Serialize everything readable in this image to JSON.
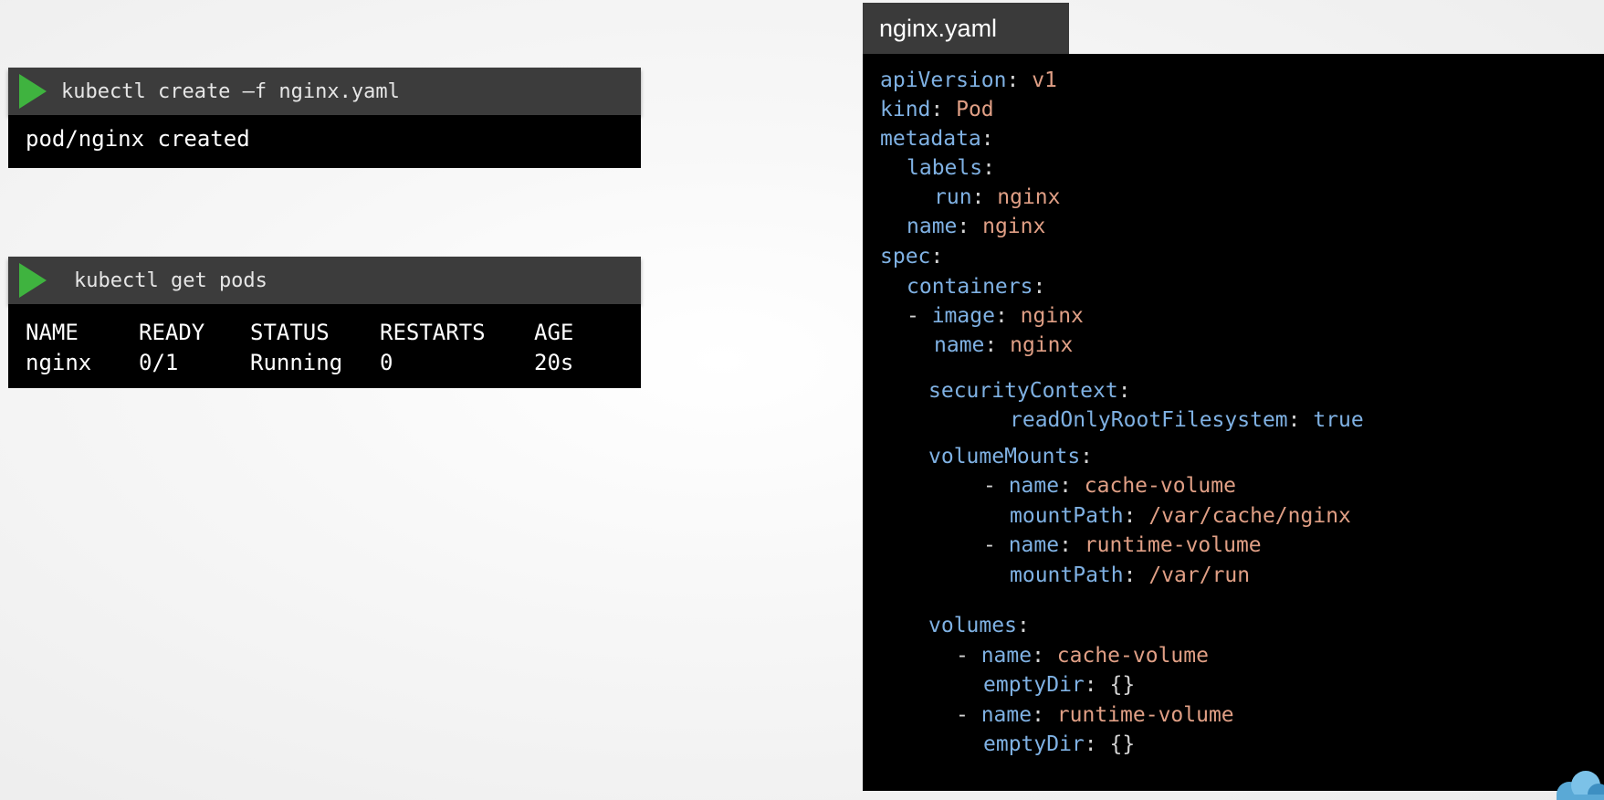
{
  "terminal1": {
    "command": "kubectl create –f nginx.yaml",
    "output": "pod/nginx created"
  },
  "terminal2": {
    "command": "kubectl get pods",
    "headers": [
      "NAME",
      "READY",
      "STATUS",
      "RESTARTS",
      "AGE"
    ],
    "rows": [
      [
        "nginx",
        "0/1",
        "Running",
        "0",
        "20s"
      ]
    ]
  },
  "file": {
    "tab_label": "nginx.yaml",
    "tokens": {
      "apiVersion_key": "apiVersion",
      "apiVersion_val": "v1",
      "kind_key": "kind",
      "kind_val": "Pod",
      "metadata_key": "metadata",
      "labels_key": "labels",
      "run_key": "run",
      "run_val": "nginx",
      "name_key": "name",
      "name_val": "nginx",
      "spec_key": "spec",
      "containers_key": "containers",
      "image_key": "image",
      "image_val": "nginx",
      "cname_key": "name",
      "cname_val": "nginx",
      "securityContext_key": "securityContext",
      "readOnly_key": "readOnlyRootFilesystem",
      "readOnly_val": "true",
      "volumeMounts_key": "volumeMounts",
      "vm1_name_key": "name",
      "vm1_name_val": "cache-volume",
      "vm1_path_key": "mountPath",
      "vm1_path_val": "/var/cache/nginx",
      "vm2_name_key": "name",
      "vm2_name_val": "runtime-volume",
      "vm2_path_key": "mountPath",
      "vm2_path_val": "/var/run",
      "volumes_key": "volumes",
      "v1_name_key": "name",
      "v1_name_val": "cache-volume",
      "v1_empty_key": "emptyDir",
      "v1_empty_val": "{}",
      "v2_name_key": "name",
      "v2_name_val": "runtime-volume",
      "v2_empty_key": "emptyDir",
      "v2_empty_val": "{}"
    }
  },
  "colors": {
    "yaml_key": "#7fb1e3",
    "yaml_value": "#e09f85",
    "play_icon": "#3fb33f",
    "terminal_bar": "#3c3c3c"
  },
  "icons": [
    "play-icon",
    "cloud-icon"
  ]
}
